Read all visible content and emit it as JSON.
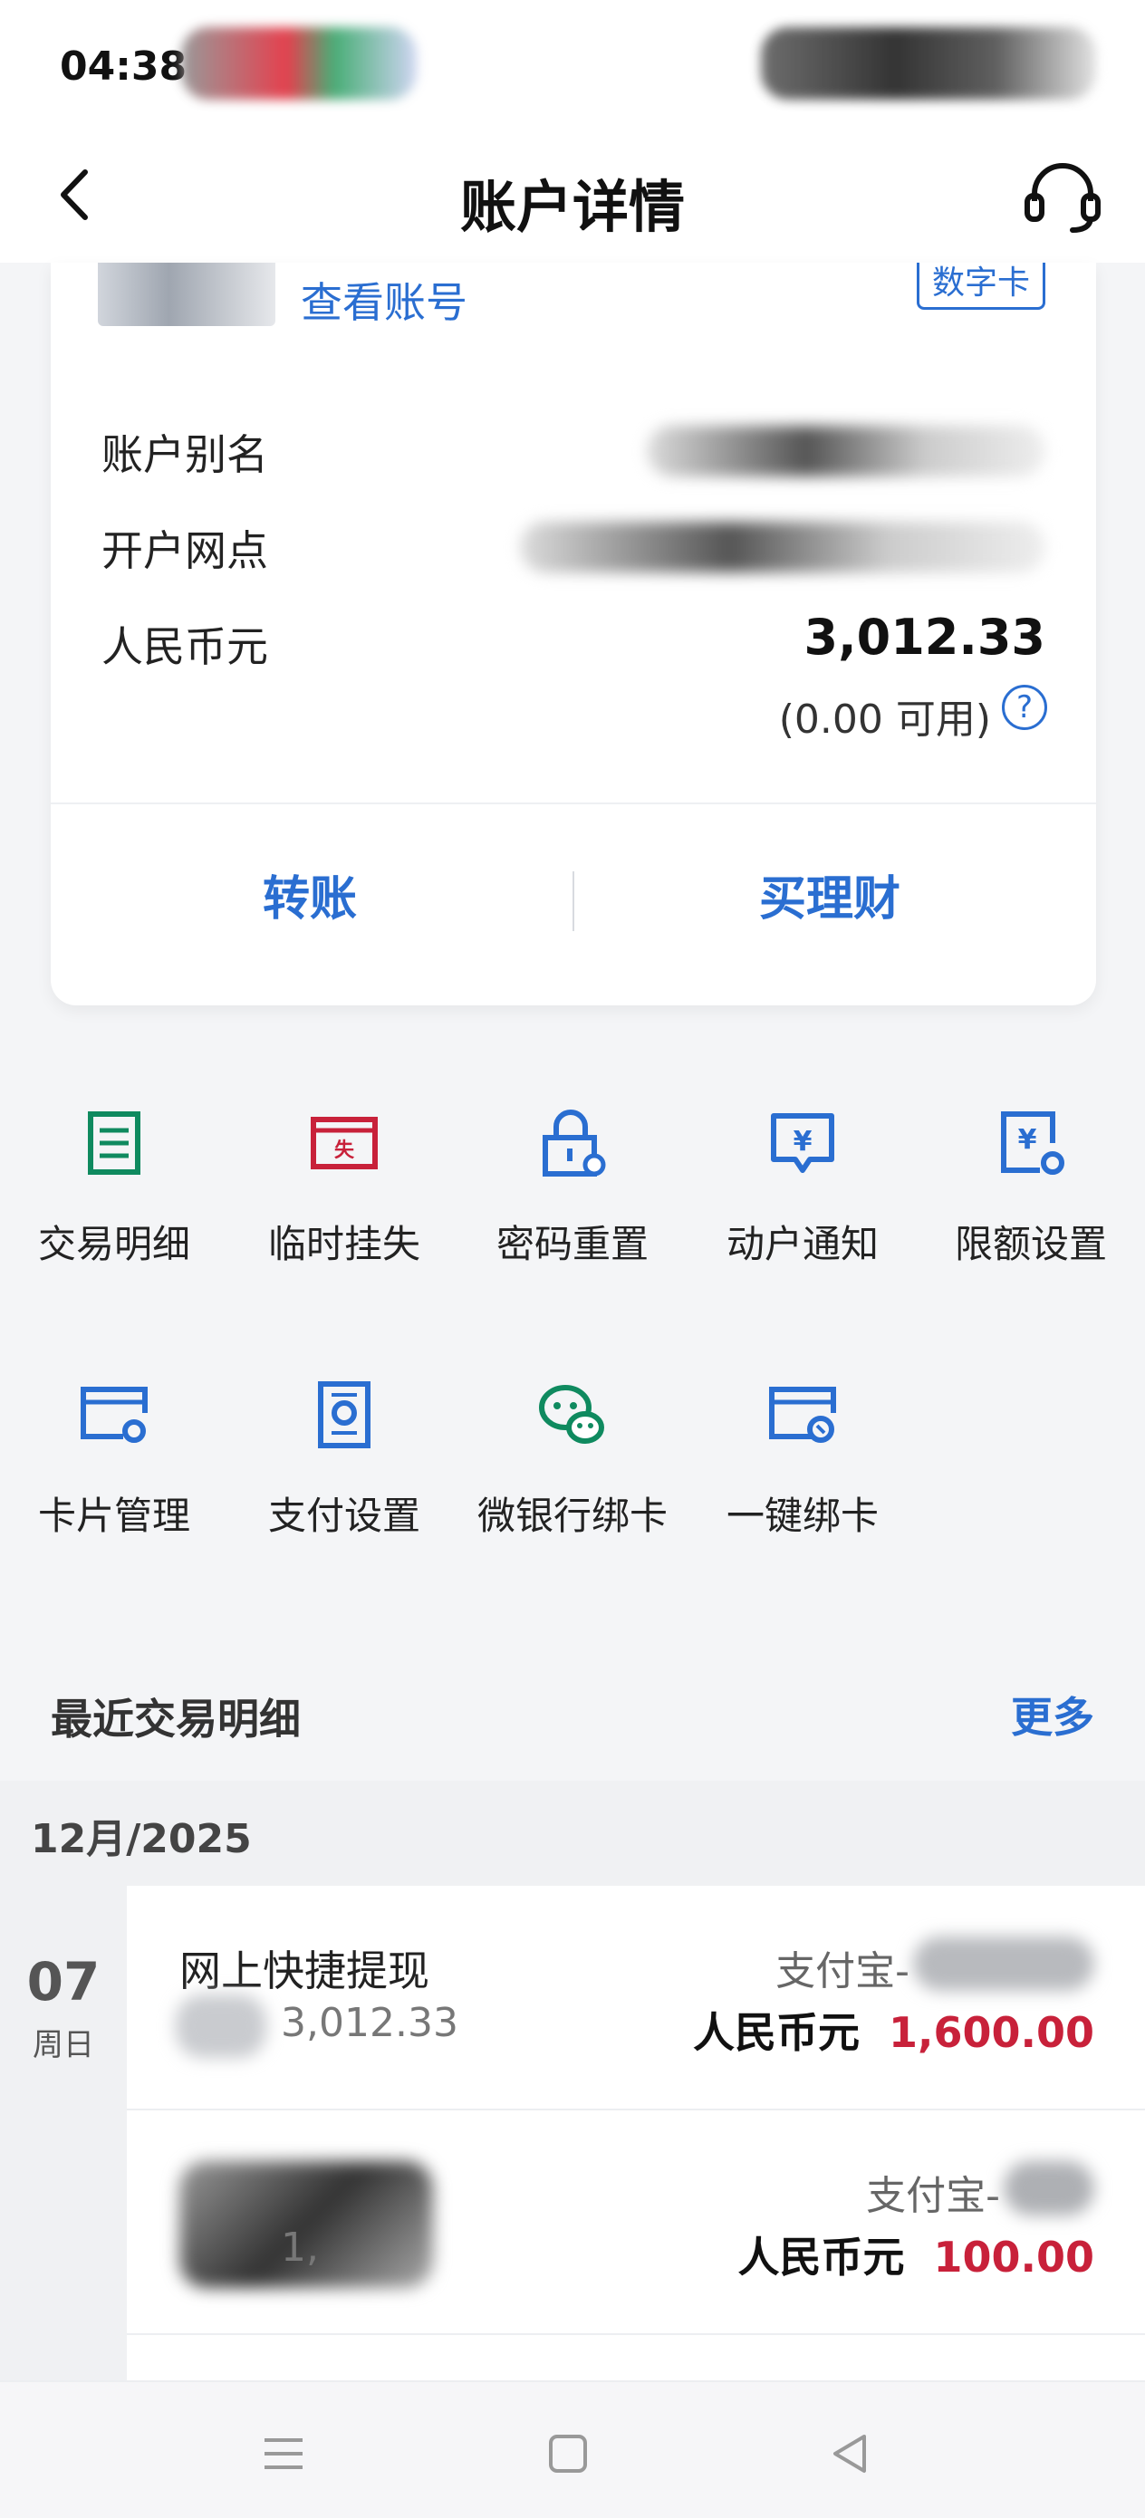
{
  "status_bar": {
    "time": "04:38"
  },
  "nav": {
    "title": "账户详情"
  },
  "card": {
    "view_account": "查看账号",
    "digital_tag": "数字卡",
    "rows": [
      {
        "label": "账户别名"
      },
      {
        "label": "开户网点"
      },
      {
        "label": "人民币元",
        "balance": "3,012.33",
        "available": "(0.00 可用)"
      }
    ],
    "actions": {
      "transfer": "转账",
      "wealth": "买理财"
    }
  },
  "menu": [
    {
      "label": "交易明细",
      "icon": "ledger-icon"
    },
    {
      "label": "临时挂失",
      "icon": "loss-report-icon"
    },
    {
      "label": "密码重置",
      "icon": "lock-reset-icon"
    },
    {
      "label": "动户通知",
      "icon": "yuan-notify-icon"
    },
    {
      "label": "限额设置",
      "icon": "limit-settings-icon"
    },
    {
      "label": "卡片管理",
      "icon": "card-settings-icon"
    },
    {
      "label": "支付设置",
      "icon": "payment-settings-icon"
    },
    {
      "label": "微银行绑卡",
      "icon": "wechat-icon"
    },
    {
      "label": "一键绑卡",
      "icon": "card-link-icon"
    }
  ],
  "recent": {
    "title": "最近交易明细",
    "more": "更多",
    "month": "12月/2025",
    "day": "07",
    "weekday": "周日",
    "transactions": [
      {
        "title": "网上快捷提现",
        "balance": "3,012.33",
        "counterparty": "支付宝-",
        "currency": "人民币元",
        "amount": "1,600.00"
      },
      {
        "title": "",
        "balance": "1,",
        "counterparty": "支付宝-",
        "currency": "人民币元",
        "amount": "100.00"
      }
    ]
  },
  "colors": {
    "accent": "#2a6ed1",
    "amount": "#c8213a",
    "menu_green": "#0f8a5f",
    "menu_red": "#c8213a"
  }
}
